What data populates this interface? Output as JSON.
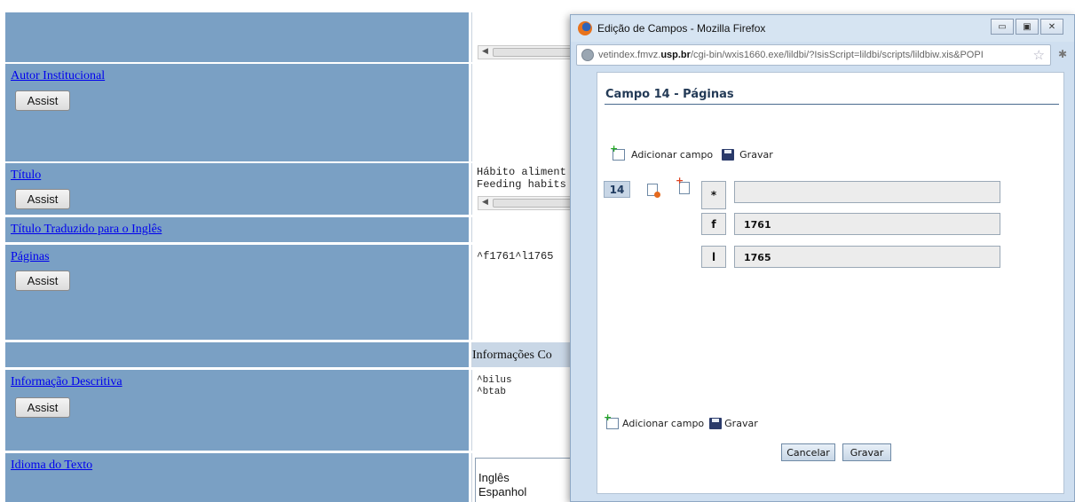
{
  "form": {
    "assist_label": "Assist",
    "rows": {
      "autor_institucional": {
        "label": "Autor Institucional"
      },
      "titulo": {
        "label": "Título",
        "value_line1": "Hábito aliment",
        "value_line2": "Feeding habits"
      },
      "titulo_traduzido": {
        "label": "Título Traduzido para o Inglês"
      },
      "paginas": {
        "label": "Páginas",
        "value": "^f1761^l1765"
      },
      "informacoes_section": {
        "header": "Informações Co"
      },
      "informacao_descritiva": {
        "label": "Informação Descritiva",
        "value_line1": "^bilus",
        "value_line2": "^btab"
      },
      "idioma": {
        "label": "Idioma do Texto",
        "option1": "Inglês",
        "option2": "Espanhol"
      }
    }
  },
  "popup": {
    "window_title": "Edição de Campos - Mozilla Firefox",
    "url_pre": "vetindex.fmvz.",
    "url_domain": "usp.br",
    "url_post": "/cgi-bin/wxis1660.exe/lildbi/?IsisScript=lildbi/scripts/lildbiw.xis&POPI",
    "window_buttons": {
      "minimize": "▭",
      "maximize": "▣",
      "close": "✕"
    },
    "heading": "Campo 14 - Páginas",
    "toolbar": {
      "add_label": "Adicionar campo",
      "save_label": "Gravar"
    },
    "field_number": "14",
    "subfields": [
      {
        "code": "*",
        "value": ""
      },
      {
        "code": "f",
        "value": "1761"
      },
      {
        "code": "l",
        "value": "1765"
      }
    ],
    "bottom_toolbar": {
      "add_label": "Adicionar campo",
      "save_label": "Gravar"
    },
    "buttons": {
      "cancel": "Cancelar",
      "save": "Gravar"
    }
  }
}
